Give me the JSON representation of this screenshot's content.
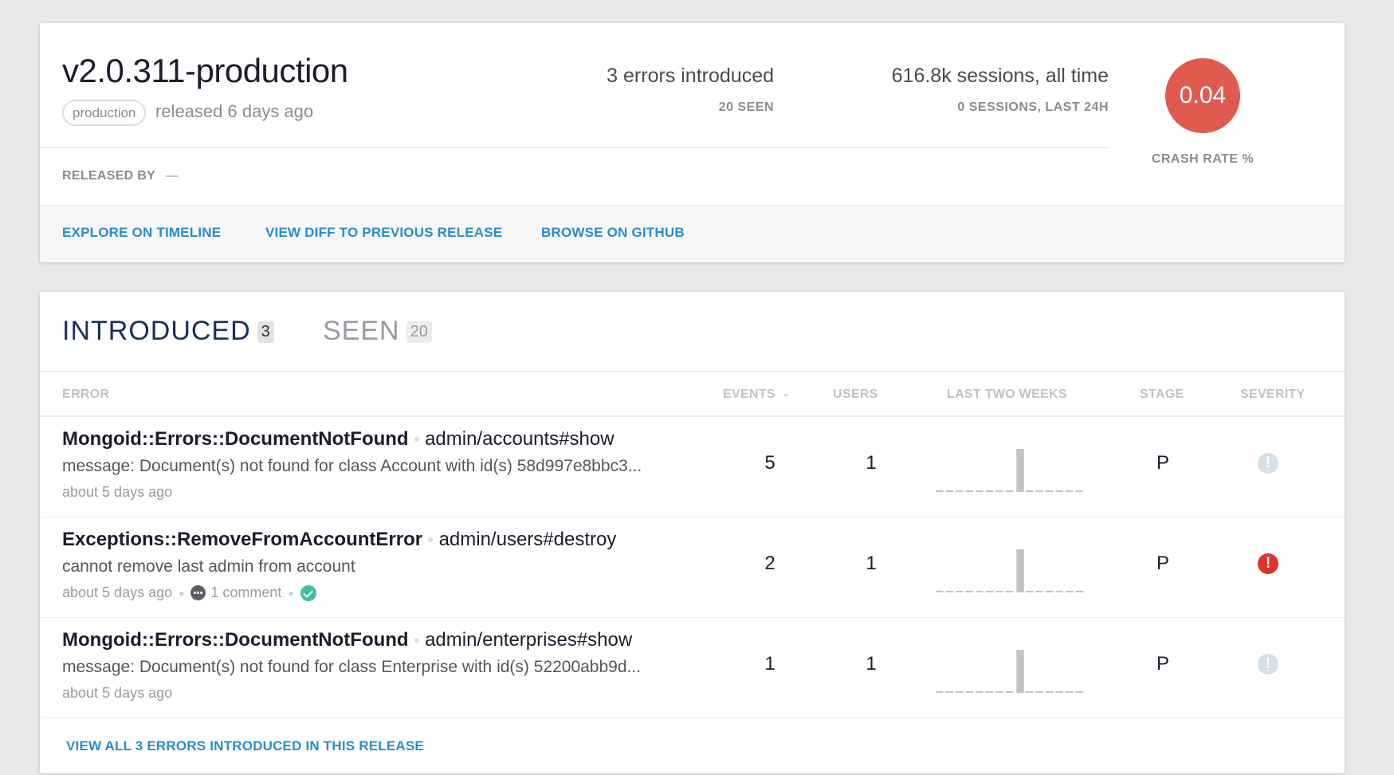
{
  "release": {
    "version": "v2.0.311-production",
    "environment": "production",
    "released_ago": "released 6 days ago",
    "errors_introduced": "3 errors introduced",
    "errors_seen": "20 SEEN",
    "sessions_all_time": "616.8k sessions, all time",
    "sessions_last_24h": "0 SESSIONS, LAST 24H",
    "crash_rate": "0.04",
    "crash_rate_label": "CRASH RATE %",
    "crash_rate_color": "#e05a50",
    "released_by_label": "RELEASED BY",
    "released_by_value": "—",
    "links": {
      "timeline": "EXPLORE ON TIMELINE",
      "diff": "VIEW DIFF TO PREVIOUS RELEASE",
      "github": "BROWSE ON GITHUB"
    }
  },
  "errors": {
    "tabs": [
      {
        "label": "INTRODUCED",
        "count": "3",
        "active": true
      },
      {
        "label": "SEEN",
        "count": "20",
        "active": false
      }
    ],
    "columns": {
      "error": "ERROR",
      "events": "EVENTS",
      "events_sort_icon": "chevron-down-icon",
      "users": "USERS",
      "last_two_weeks": "LAST TWO WEEKS",
      "stage": "STAGE",
      "severity": "SEVERITY"
    },
    "rows": [
      {
        "type": "Mongoid::Errors::DocumentNotFound",
        "context": "admin/accounts#show",
        "message": "message: Document(s) not found for class Account with id(s) 58d997e8bbc3...",
        "time": "about 5 days ago",
        "events": "5",
        "users": "1",
        "stage": "P",
        "severity": "info",
        "severity_color": "#d3e1e8",
        "trend": [
          0,
          0,
          0,
          0,
          0,
          0,
          0,
          0,
          5,
          0,
          0,
          0,
          0,
          0,
          0
        ]
      },
      {
        "type": "Exceptions::RemoveFromAccountError",
        "context": "admin/users#destroy",
        "message": "cannot remove last admin from account",
        "time": "about 5 days ago",
        "comments": "1 comment",
        "resolved_icon": "check-circle-icon",
        "events": "2",
        "users": "1",
        "stage": "P",
        "severity": "error",
        "severity_color": "#e0322b",
        "trend": [
          0,
          0,
          0,
          0,
          0,
          0,
          0,
          0,
          2,
          0,
          0,
          0,
          0,
          0,
          0
        ]
      },
      {
        "type": "Mongoid::Errors::DocumentNotFound",
        "context": "admin/enterprises#show",
        "message": "message: Document(s) not found for class Enterprise with id(s) 52200abb9d...",
        "time": "about 5 days ago",
        "events": "1",
        "users": "1",
        "stage": "P",
        "severity": "info",
        "severity_color": "#d3e1e8",
        "trend": [
          0,
          0,
          0,
          0,
          0,
          0,
          0,
          0,
          1,
          0,
          0,
          0,
          0,
          0,
          0
        ]
      }
    ],
    "view_all": "VIEW ALL 3 ERRORS INTRODUCED IN THIS RELEASE"
  }
}
